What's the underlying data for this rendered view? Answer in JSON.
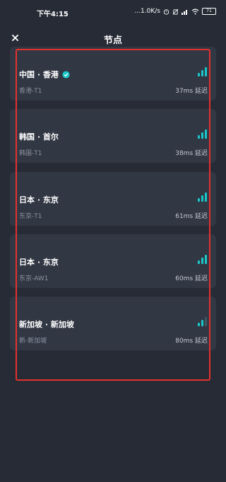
{
  "status_bar": {
    "time": "下午4:15",
    "network_speed": "...1.0K/s",
    "battery": "71"
  },
  "header": {
    "close_glyph": "✕",
    "title": "节点"
  },
  "colors": {
    "background": "#272b36",
    "card": "#323744",
    "accent": "#19c8c8",
    "highlight": "#e3312d"
  },
  "nodes": [
    {
      "name": "中国 · 香港",
      "verified": true,
      "sub": "香港-T1",
      "latency": "37ms 延迟",
      "signal_bars": 3
    },
    {
      "name": "韩国 · 首尔",
      "verified": false,
      "sub": "韩国-T1",
      "latency": "38ms 延迟",
      "signal_bars": 3
    },
    {
      "name": "日本 · 东京",
      "verified": false,
      "sub": "东京-T1",
      "latency": "61ms 延迟",
      "signal_bars": 3
    },
    {
      "name": "日本 · 东京",
      "verified": false,
      "sub": "东京-AW1",
      "latency": "60ms 延迟",
      "signal_bars": 3
    },
    {
      "name": "新加坡 · 新加坡",
      "verified": false,
      "sub": "新-新加坡",
      "latency": "80ms 延迟",
      "signal_bars": 2
    }
  ]
}
